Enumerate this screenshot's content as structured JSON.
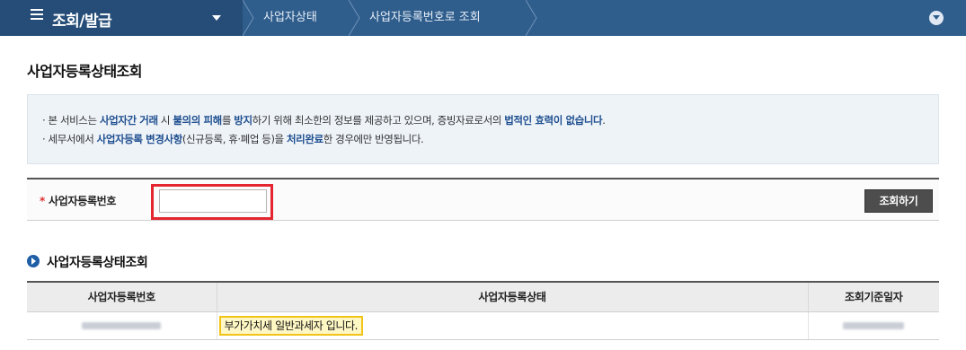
{
  "nav": {
    "menu_title": "조회/발급",
    "breadcrumbs": [
      "사업자상태",
      "사업자등록번호로 조회"
    ],
    "menu_icon": "hamburger-icon",
    "expand_icon": "chevron-down-circle-icon"
  },
  "page": {
    "title": "사업자등록상태조회"
  },
  "notice": {
    "line1": [
      {
        "t": "본 서비스는 ",
        "hl": false
      },
      {
        "t": "사업자간 거래",
        "hl": true
      },
      {
        "t": " 시 ",
        "hl": false
      },
      {
        "t": "불의의 피해",
        "hl": true
      },
      {
        "t": "를 ",
        "hl": false
      },
      {
        "t": "방지",
        "hl": true
      },
      {
        "t": "하기 위해 최소한의 정보를 제공하고 있으며, 증빙자료로서의 ",
        "hl": false
      },
      {
        "t": "법적인 효력이 없습니다",
        "hl": true
      },
      {
        "t": ".",
        "hl": false
      }
    ],
    "line2": [
      {
        "t": "세무서에서 ",
        "hl": false
      },
      {
        "t": "사업자등록 변경사항",
        "hl": true
      },
      {
        "t": "(신규등록, 휴·폐업 등)을 ",
        "hl": false
      },
      {
        "t": "처리완료",
        "hl": true
      },
      {
        "t": "한 경우에만 반영됩니다.",
        "hl": false
      }
    ]
  },
  "search": {
    "required_mark": "*",
    "label": "사업자등록번호",
    "input_value": "",
    "button_label": "조회하기"
  },
  "result": {
    "section_title": "사업자등록상태조회",
    "columns": [
      "사업자등록번호",
      "사업자등록상태",
      "조회기준일자"
    ],
    "rows": [
      {
        "status": "부가가치세 일반과세자 입니다."
      }
    ]
  },
  "colors": {
    "nav_bg": "#2f5d8c",
    "highlight_text": "#1f4f8f",
    "input_highlight_border": "#e3262f",
    "status_highlight_border": "#f2c318"
  }
}
